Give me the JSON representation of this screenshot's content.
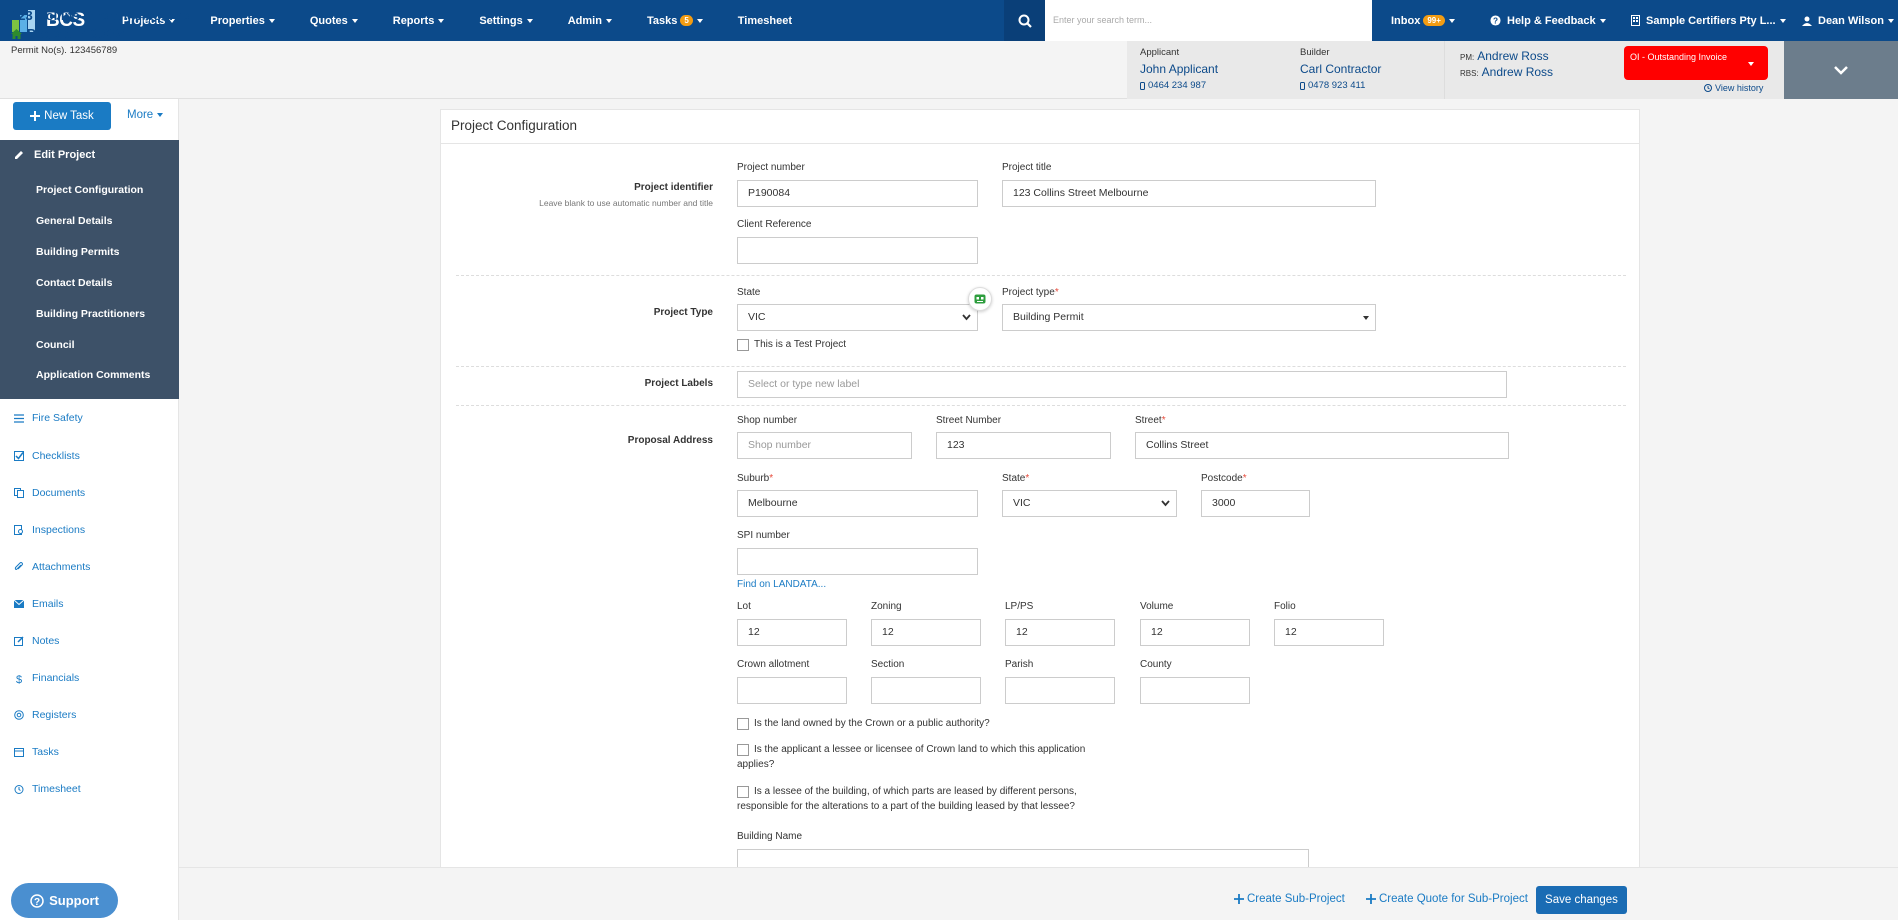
{
  "brand": {
    "name": "BCS"
  },
  "nav": {
    "items": [
      "Projects",
      "Properties",
      "Quotes",
      "Reports",
      "Settings",
      "Admin"
    ],
    "tasks_label": "Tasks",
    "tasks_badge": "5",
    "timesheet": "Timesheet",
    "search_placeholder": "Enter your search term...",
    "inbox_label": "Inbox",
    "inbox_badge": "99+",
    "help_label": "Help & Feedback",
    "org_label": "Sample Certifiers Pty L...",
    "user_label": "Dean Wilson"
  },
  "project": {
    "title": "123 Collins Street Melbourne",
    "number_label": "Project P190084",
    "permits": "Permit No(s). 123456789",
    "applicant_label": "Applicant",
    "applicant_name": "John Applicant",
    "applicant_phone": "0464 234 987",
    "builder_label": "Builder",
    "builder_name": "Carl Contractor",
    "builder_phone": "0478 923 411",
    "pm_label": "PM:",
    "pm_name": "Andrew Ross",
    "rbs_label": "RBS:",
    "rbs_name": "Andrew Ross",
    "status": "OI - Outstanding Invoice",
    "view_history": "View history"
  },
  "sidebar": {
    "new_task": "New Task",
    "more": "More",
    "edit_project": "Edit Project",
    "sub_items": [
      "Project Configuration",
      "General Details",
      "Building Permits",
      "Contact Details",
      "Building Practitioners",
      "Council",
      "Application Comments"
    ],
    "items": [
      {
        "label": "Fire Safety",
        "icon": "list-icon"
      },
      {
        "label": "Checklists",
        "icon": "checkbox-icon"
      },
      {
        "label": "Documents",
        "icon": "documents-icon"
      },
      {
        "label": "Inspections",
        "icon": "inspection-icon"
      },
      {
        "label": "Attachments",
        "icon": "paperclip-icon"
      },
      {
        "label": "Emails",
        "icon": "envelope-icon"
      },
      {
        "label": "Notes",
        "icon": "note-icon"
      },
      {
        "label": "Financials",
        "icon": "dollar-icon"
      },
      {
        "label": "Registers",
        "icon": "register-icon"
      },
      {
        "label": "Tasks",
        "icon": "tasks-icon"
      },
      {
        "label": "Timesheet",
        "icon": "clock-icon"
      }
    ],
    "support": "Support"
  },
  "form": {
    "title": "Project Configuration",
    "identifier": {
      "label": "Project identifier",
      "hint": "Leave blank to use automatic number and title",
      "project_number_label": "Project number",
      "project_number": "P190084",
      "project_title_label": "Project title",
      "project_title": "123 Collins Street Melbourne",
      "client_ref_label": "Client Reference",
      "client_ref": ""
    },
    "type": {
      "label": "Project Type",
      "state_label": "State",
      "state": "VIC",
      "project_type_label": "Project type",
      "project_type": "Building Permit",
      "test_project_label": "This is a Test Project"
    },
    "labels": {
      "label": "Project Labels",
      "placeholder": "Select or type new label"
    },
    "address": {
      "label": "Proposal Address",
      "shop_label": "Shop number",
      "shop_placeholder": "Shop number",
      "street_number_label": "Street Number",
      "street_number": "123",
      "street_label": "Street",
      "street": "Collins Street",
      "suburb_label": "Suburb",
      "suburb": "Melbourne",
      "state_label": "State",
      "state": "VIC",
      "postcode_label": "Postcode",
      "postcode": "3000",
      "spi_label": "SPI number",
      "spi": "",
      "landata_link": "Find on LANDATA...",
      "lot_label": "Lot",
      "lot": "12",
      "zoning_label": "Zoning",
      "zoning": "12",
      "lpps_label": "LP/PS",
      "lpps": "12",
      "volume_label": "Volume",
      "volume": "12",
      "folio_label": "Folio",
      "folio": "12",
      "crown_label": "Crown allotment",
      "section_label": "Section",
      "parish_label": "Parish",
      "county_label": "County",
      "q1": "Is the land owned by the Crown or a public authority?",
      "q2a": "Is the applicant a lessee or licensee of Crown land to which this application",
      "q2b": "applies?",
      "q3a": "Is a lessee of the building, of which parts are leased by different persons,",
      "q3b": "responsible for the alterations to a part of the building leased by that lessee?",
      "building_name_label": "Building Name"
    }
  },
  "footer": {
    "create_sub": "Create Sub-Project",
    "create_quote": "Create Quote for Sub-Project",
    "save": "Save changes"
  }
}
